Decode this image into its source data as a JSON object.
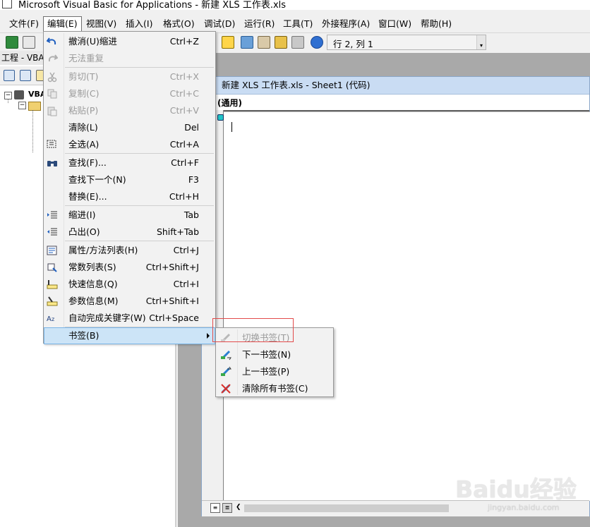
{
  "window": {
    "title": "Microsoft Visual Basic for Applications - 新建 XLS 工作表.xls"
  },
  "menubar": [
    {
      "label": "文件(F)"
    },
    {
      "label": "编辑(E)"
    },
    {
      "label": "视图(V)"
    },
    {
      "label": "插入(I)"
    },
    {
      "label": "格式(O)"
    },
    {
      "label": "调试(D)"
    },
    {
      "label": "运行(R)"
    },
    {
      "label": "工具(T)"
    },
    {
      "label": "外接程序(A)"
    },
    {
      "label": "窗口(W)"
    },
    {
      "label": "帮助(H)"
    }
  ],
  "toolbar": {
    "position_status": "行 2, 列 1"
  },
  "project": {
    "header": "工程 - VBAP",
    "root_label": "VBA"
  },
  "code_window": {
    "title": "新建 XLS 工作表.xls - Sheet1 (代码)",
    "object_combo": "(通用)"
  },
  "edit_menu": {
    "items": [
      {
        "label": "撤消(U)缩进",
        "shortcut": "Ctrl+Z",
        "disabled": false
      },
      {
        "label": "无法重复",
        "shortcut": "",
        "disabled": true
      },
      {
        "label": "剪切(T)",
        "shortcut": "Ctrl+X",
        "disabled": true
      },
      {
        "label": "复制(C)",
        "shortcut": "Ctrl+C",
        "disabled": true
      },
      {
        "label": "粘贴(P)",
        "shortcut": "Ctrl+V",
        "disabled": true
      },
      {
        "label": "清除(L)",
        "shortcut": "Del",
        "disabled": false
      },
      {
        "label": "全选(A)",
        "shortcut": "Ctrl+A",
        "disabled": false
      },
      {
        "label": "查找(F)...",
        "shortcut": "Ctrl+F",
        "disabled": false
      },
      {
        "label": "查找下一个(N)",
        "shortcut": "F3",
        "disabled": false
      },
      {
        "label": "替换(E)...",
        "shortcut": "Ctrl+H",
        "disabled": false
      },
      {
        "label": "缩进(I)",
        "shortcut": "Tab",
        "disabled": false
      },
      {
        "label": "凸出(O)",
        "shortcut": "Shift+Tab",
        "disabled": false
      },
      {
        "label": "属性/方法列表(H)",
        "shortcut": "Ctrl+J",
        "disabled": false
      },
      {
        "label": "常数列表(S)",
        "shortcut": "Ctrl+Shift+J",
        "disabled": false
      },
      {
        "label": "快速信息(Q)",
        "shortcut": "Ctrl+I",
        "disabled": false
      },
      {
        "label": "参数信息(M)",
        "shortcut": "Ctrl+Shift+I",
        "disabled": false
      },
      {
        "label": "自动完成关键字(W)",
        "shortcut": "Ctrl+Space",
        "disabled": false
      },
      {
        "label": "书签(B)",
        "shortcut": "",
        "disabled": false
      }
    ]
  },
  "bookmark_submenu": {
    "items": [
      {
        "label": "切换书签(T)",
        "disabled": true
      },
      {
        "label": "下一书签(N)",
        "disabled": false
      },
      {
        "label": "上一书签(P)",
        "disabled": false
      },
      {
        "label": "清除所有书签(C)",
        "disabled": false
      }
    ]
  },
  "watermark": {
    "main": "Baidu经验",
    "sub": "jingyan.baidu.com"
  },
  "colors": {
    "highlight": "#cce4f7",
    "annotation": "#e24b4b",
    "mdi_bg": "#a9a9a9"
  }
}
